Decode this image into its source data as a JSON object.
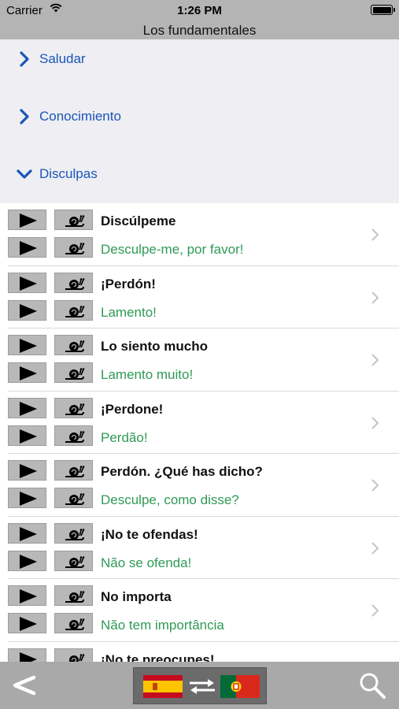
{
  "status_bar": {
    "carrier": "Carrier",
    "time": "1:26 PM"
  },
  "nav": {
    "title": "Los fundamentales"
  },
  "sections": [
    {
      "label": "Saludar",
      "expanded": false
    },
    {
      "label": "Conocimiento",
      "expanded": false
    },
    {
      "label": "Disculpas",
      "expanded": true
    }
  ],
  "phrases": [
    {
      "es": "Discúlpeme",
      "pt": "Desculpe-me, por favor!"
    },
    {
      "es": "¡Perdón!",
      "pt": "Lamento!"
    },
    {
      "es": "Lo siento mucho",
      "pt": "Lamento muito!"
    },
    {
      "es": "¡Perdone!",
      "pt": "Perdão!"
    },
    {
      "es": "Perdón. ¿Qué has dicho?",
      "pt": "Desculpe, como disse?"
    },
    {
      "es": "¡No te ofendas!",
      "pt": "Não se ofenda!"
    },
    {
      "es": "No importa",
      "pt": "Não tem importância"
    },
    {
      "es": "¡No te preocupes!",
      "pt": ""
    }
  ],
  "toolbar": {
    "back_icon": "back-chevron-icon",
    "source_flag": "spain-flag-icon",
    "swap_icon": "swap-arrows-icon",
    "target_flag": "portugal-flag-icon",
    "search_icon": "search-icon"
  },
  "colors": {
    "section_label": "#1a56b8",
    "translation": "#2e9a55",
    "nav_bg": "#b4b4b4",
    "toolbar_bg": "#a9a9a9"
  }
}
